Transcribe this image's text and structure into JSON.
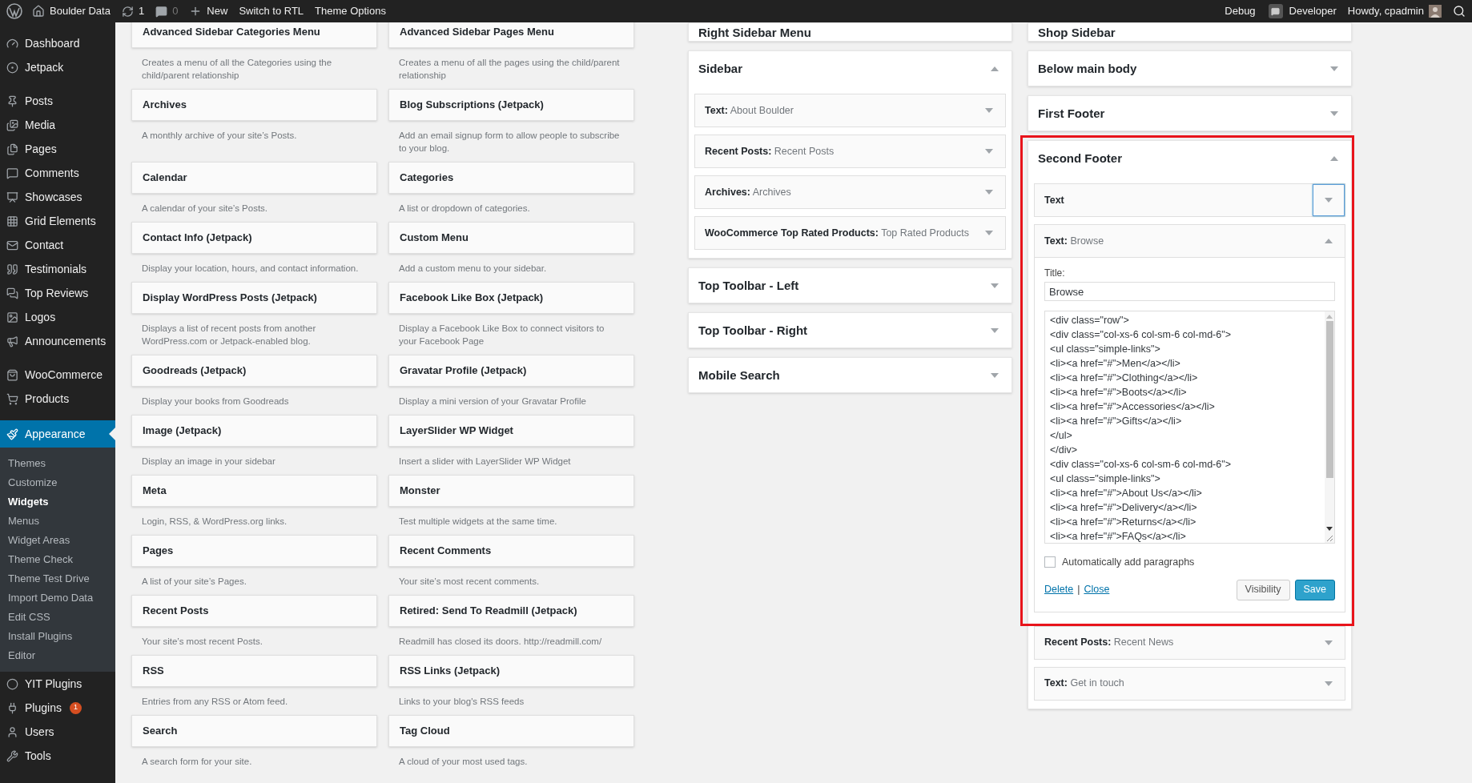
{
  "admin_bar": {
    "site": "Boulder Data",
    "updates": "1",
    "comments": "0",
    "new": "New",
    "links": [
      "Switch to RTL",
      "Theme Options"
    ],
    "debug": "Debug",
    "developer": "Developer",
    "greeting": "Howdy, cpadmin"
  },
  "menu": [
    [
      {
        "label": "Dashboard",
        "selected": false
      },
      {
        "label": "Jetpack",
        "selected": false
      }
    ],
    [
      {
        "label": "Posts",
        "selected": false
      },
      {
        "label": "Media",
        "selected": false
      },
      {
        "label": "Pages",
        "selected": false
      },
      {
        "label": "Comments",
        "selected": false
      },
      {
        "label": "Showcases",
        "selected": false
      },
      {
        "label": "Grid Elements",
        "selected": false
      },
      {
        "label": "Contact",
        "selected": false
      },
      {
        "label": "Testimonials",
        "selected": false
      },
      {
        "label": "Top Reviews",
        "selected": false
      },
      {
        "label": "Logos",
        "selected": false
      },
      {
        "label": "Announcements",
        "selected": false
      }
    ],
    [
      {
        "label": "WooCommerce",
        "selected": false
      },
      {
        "label": "Products",
        "selected": false
      }
    ],
    [
      {
        "label": "Appearance",
        "selected": true,
        "submenu": [
          {
            "label": "Themes",
            "selected": false
          },
          {
            "label": "Customize",
            "selected": false
          },
          {
            "label": "Widgets",
            "selected": true
          },
          {
            "label": "Menus",
            "selected": false
          },
          {
            "label": "Widget Areas",
            "selected": false
          },
          {
            "label": "Theme Check",
            "selected": false
          },
          {
            "label": "Theme Test Drive",
            "selected": false
          },
          {
            "label": "Import Demo Data",
            "selected": false
          },
          {
            "label": "Edit CSS",
            "selected": false
          },
          {
            "label": "Install Plugins",
            "selected": false
          },
          {
            "label": "Editor",
            "selected": false
          }
        ]
      },
      {
        "label": "YIT Plugins",
        "selected": false
      },
      {
        "label": "Plugins",
        "selected": false,
        "badge": "1"
      },
      {
        "label": "Users",
        "selected": false
      },
      {
        "label": "Tools",
        "selected": false
      }
    ]
  ],
  "available_widgets": [
    {
      "title": "Advanced Sidebar Categories Menu",
      "description": "Creates a menu of all the Categories using the child/parent relationship"
    },
    {
      "title": "Advanced Sidebar Pages Menu",
      "description": "Creates a menu of all the pages using the child/parent relationship"
    },
    {
      "title": "Archives",
      "description": "A monthly archive of your site’s Posts."
    },
    {
      "title": "Blog Subscriptions (Jetpack)",
      "description": "Add an email signup form to allow people to subscribe to your blog."
    },
    {
      "title": "Calendar",
      "description": "A calendar of your site’s Posts."
    },
    {
      "title": "Categories",
      "description": "A list or dropdown of categories."
    },
    {
      "title": "Contact Info (Jetpack)",
      "description": "Display your location, hours, and contact information."
    },
    {
      "title": "Custom Menu",
      "description": "Add a custom menu to your sidebar."
    },
    {
      "title": "Display WordPress Posts (Jetpack)",
      "description": "Displays a list of recent posts from another WordPress.com or Jetpack-enabled blog."
    },
    {
      "title": "Facebook Like Box (Jetpack)",
      "description": "Display a Facebook Like Box to connect visitors to your Facebook Page"
    },
    {
      "title": "Goodreads (Jetpack)",
      "description": "Display your books from Goodreads"
    },
    {
      "title": "Gravatar Profile (Jetpack)",
      "description": "Display a mini version of your Gravatar Profile"
    },
    {
      "title": "Image (Jetpack)",
      "description": "Display an image in your sidebar"
    },
    {
      "title": "LayerSlider WP Widget",
      "description": "Insert a slider with LayerSlider WP Widget"
    },
    {
      "title": "Meta",
      "description": "Login, RSS, & WordPress.org links."
    },
    {
      "title": "Monster",
      "description": "Test multiple widgets at the same time."
    },
    {
      "title": "Pages",
      "description": "A list of your site’s Pages."
    },
    {
      "title": "Recent Comments",
      "description": "Your site’s most recent comments."
    },
    {
      "title": "Recent Posts",
      "description": "Your site’s most recent Posts."
    },
    {
      "title": "Retired: Send To Readmill (Jetpack)",
      "description": "Readmill has closed its doors. http://readmill.com/"
    },
    {
      "title": "RSS",
      "description": "Entries from any RSS or Atom feed."
    },
    {
      "title": "RSS Links (Jetpack)",
      "description": "Links to your blog's RSS feeds"
    },
    {
      "title": "Search",
      "description": "A search form for your site."
    },
    {
      "title": "Tag Cloud",
      "description": "A cloud of your most used tags."
    }
  ],
  "widget_areas": [
    [
      {
        "title": "Right Sidebar Menu"
      },
      {
        "title": "Sidebar",
        "expanded": true,
        "widgets": [
          {
            "label": "**Text:** About Boulder",
            "expanded": false
          },
          {
            "label": "**Recent Posts:** Recent Posts",
            "expanded": false
          },
          {
            "label": "**Archives:** Archives",
            "expanded": false
          },
          {
            "label": "**WooCommerce Top Rated Products:** Top Rated Products",
            "expanded": false
          }
        ]
      },
      {
        "title": "Top Toolbar - Left",
        "expanded": false
      },
      {
        "title": "Top Toolbar - Right",
        "expanded": false
      },
      {
        "title": "Mobile Search",
        "expanded": false
      }
    ],
    [
      {
        "title": "Shop Sidebar"
      },
      {
        "title": "Below main body",
        "expanded": false
      },
      {
        "title": "First Footer",
        "expanded": false
      },
      {
        "title": "Second Footer",
        "expanded": true,
        "highlighted": true,
        "widgets": [
          {
            "label": "**Text**",
            "expanded": false,
            "focused": true,
            "highlighted": true
          },
          {
            "label": "**Text:** Browse",
            "expanded": true,
            "highlighted": true,
            "form": {
              "title_label": "Title:",
              "title_value": "Browse",
              "content_lines": [
                "<div class=\"row\">",
                "<div class=\"col-xs-6 col-sm-6 col-md-6\">",
                "<ul class=\"simple-links\">",
                "<li><a href=\"#\">Men</a></li>",
                "<li><a href=\"#\">Clothing</a></li>",
                "<li><a href=\"#\">Boots</a></li>",
                "<li><a href=\"#\">Accessories</a></li>",
                "<li><a href=\"#\">Gifts</a></li>",
                "</ul>",
                "</div>",
                "<div class=\"col-xs-6 col-sm-6 col-md-6\">",
                "<ul class=\"simple-links\">",
                "<li><a href=\"#\">About Us</a></li>",
                "<li><a href=\"#\">Delivery</a></li>",
                "<li><a href=\"#\">Returns</a></li>",
                "<li><a href=\"#\">FAQs</a></li>"
              ],
              "autop": {
                "label": "Automatically add paragraphs",
                "checked": false
              },
              "links": [
                "Delete",
                "Close"
              ],
              "link_separator": "|",
              "buttons": [
                {
                  "label": "Visibility",
                  "kind": "secondary"
                },
                {
                  "label": "Save",
                  "kind": "primary"
                }
              ]
            }
          },
          {
            "label": "**Recent Posts:** Recent News",
            "expanded": false,
            "highlighted": false
          },
          {
            "label": "**Text:** Get in touch",
            "expanded": false,
            "highlighted": false
          }
        ]
      }
    ]
  ]
}
